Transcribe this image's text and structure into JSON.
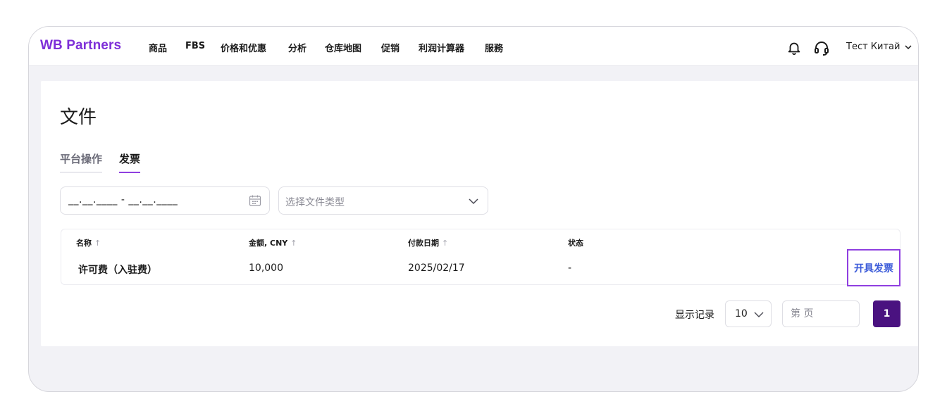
{
  "header": {
    "logo": "WB Partners",
    "nav": [
      "商品",
      "FBS",
      "价格和优惠",
      "分析",
      "仓库地图",
      "促销",
      "利润计算器",
      "服務"
    ],
    "user_name": "Тест Китай",
    "icons": {
      "notifications": "bell-icon",
      "support": "headset-icon",
      "user_menu": "chevron-down-icon"
    }
  },
  "page": {
    "title": "文件",
    "tabs": [
      {
        "label": "平台操作",
        "active": false
      },
      {
        "label": "发票",
        "active": true
      }
    ]
  },
  "filters": {
    "date_range_value": "__.__.____ - __.__.____",
    "doc_type_placeholder": "选择文件类型"
  },
  "table": {
    "columns": [
      {
        "label": "名称",
        "sort_arrow": "↑"
      },
      {
        "label": "金额, CNY",
        "sort_arrow": "↑"
      },
      {
        "label": "付款日期",
        "sort_arrow": "↑"
      },
      {
        "label": "状态",
        "sort_arrow": ""
      }
    ],
    "rows": [
      {
        "name": "许可费（入驻费）",
        "amount": "10,000",
        "date": "2025/02/17",
        "status": "-",
        "action": "开具发票"
      }
    ]
  },
  "pagination": {
    "label": "显示记录",
    "page_size": "10",
    "page_placeholder": "第 页",
    "current_page": "1"
  },
  "colors": {
    "brand": "#7e2fd8",
    "accent_outline": "#8f3fe0",
    "link": "#3b5bd9",
    "current_page_bg": "#4a1280"
  }
}
